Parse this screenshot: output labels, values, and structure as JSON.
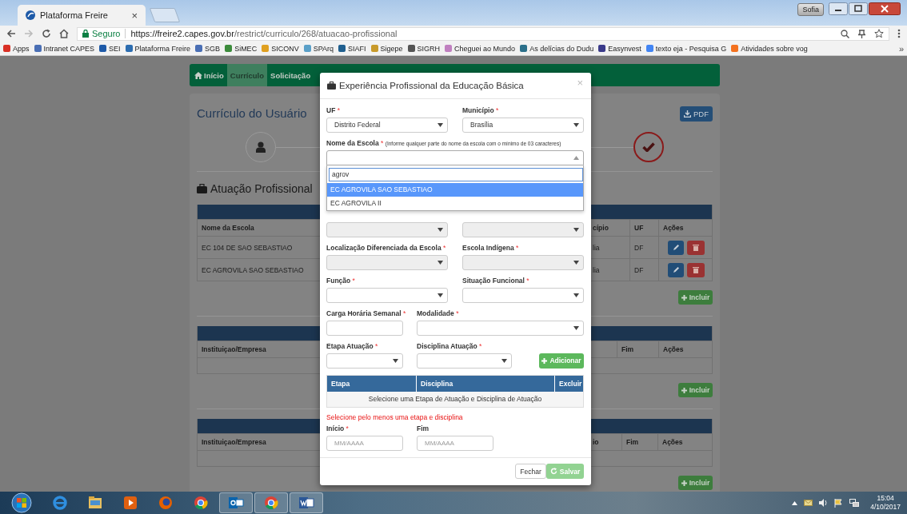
{
  "browser": {
    "tabs": [
      {
        "title": "Plataforma Freire",
        "close": "×",
        "selected": true
      }
    ],
    "profile": "Sofia",
    "address": {
      "security": "Seguro",
      "host": "https://freire2.capes.gov.br",
      "path": "/restrict/curriculo/268/atuacao-profissional"
    },
    "bookmarks": [
      {
        "label": "Apps",
        "color": "#d93025"
      },
      {
        "label": "Intranet CAPES",
        "color": "#4a6fb5"
      },
      {
        "label": "SEI",
        "color": "#1e5aa8"
      },
      {
        "label": "Plataforma Freire",
        "color": "#2c6db0"
      },
      {
        "label": "SGB",
        "color": "#4a6fb5"
      },
      {
        "label": "SiMEC",
        "color": "#3c8c3c"
      },
      {
        "label": "SICONV",
        "color": "#e0a020"
      },
      {
        "label": "SPArq",
        "color": "#5aa0c8"
      },
      {
        "label": "SIAFI",
        "color": "#1f5f8f"
      },
      {
        "label": "Sigepe",
        "color": "#c89a2a"
      },
      {
        "label": "SIGRH",
        "color": "#555555"
      },
      {
        "label": "Cheguei ao Mundo",
        "color": "#c080c0"
      },
      {
        "label": "As delícias do Dudu",
        "color": "#2a6f8a"
      },
      {
        "label": "Easynvest",
        "color": "#3a3a8a"
      },
      {
        "label": "texto eja - Pesquisa G",
        "color": "#4285f4"
      },
      {
        "label": "Atividades sobre vog",
        "color": "#f4711e"
      }
    ],
    "more": "»"
  },
  "nav": [
    {
      "label": "Início",
      "kind": "home",
      "selected": false
    },
    {
      "label": "Currículo",
      "kind": "plain",
      "selected": true
    },
    {
      "label": "Solicitação",
      "kind": "plain",
      "selected": false
    }
  ],
  "page": {
    "title": "Currículo do Usuário",
    "pdf_button": "PDF",
    "steps": [
      {
        "kind": "profile",
        "selected": false
      },
      {
        "kind": "finish",
        "selected": true
      }
    ],
    "section_title": "Atuação Profissional",
    "tables": [
      {
        "columns_left": [
          "Nome da Escola"
        ],
        "columns_right": [
          "cípio",
          "UF",
          "Ações"
        ],
        "rows": [
          {
            "left": "EC 104 DE SAO SEBASTIAO",
            "right": [
              "lia",
              "DF"
            ]
          },
          {
            "left": "EC AGROVILA SAO SEBASTIAO",
            "right": [
              "lia",
              "DF"
            ]
          }
        ],
        "button": "Incluir"
      },
      {
        "columns_left": [
          "Instituiçao/Empresa"
        ],
        "columns_right": [
          "Fim",
          "Ações"
        ],
        "button": "Incluir"
      },
      {
        "columns_left": [
          "Instituiçao/Empresa"
        ],
        "columns_right": [
          "io",
          "Fim",
          "Ações"
        ],
        "button": "Incluir"
      }
    ]
  },
  "modal": {
    "title": "Experiência Profissional da Educação Básica",
    "close": "×",
    "required_mark": "*",
    "rows": [
      {
        "fields": [
          {
            "kind": "select",
            "label": "UF",
            "required": true,
            "value": "Distrito Federal",
            "disabled": false
          },
          {
            "kind": "select",
            "label": "Município",
            "required": true,
            "value": "Brasília",
            "disabled": false
          }
        ]
      },
      {
        "fields": [
          {
            "kind": "select",
            "label": "Nome da Escola",
            "required": true,
            "hint": "(Informe qualquer parte do nome da escola com o mínimo de 03 caracteres)",
            "disabled": false,
            "open": true,
            "search": "agrov",
            "options": [
              {
                "label": "EC AGROVILA SAO SEBASTIAO",
                "selected": true
              },
              {
                "label": "EC AGROVILA II",
                "selected": false
              }
            ]
          }
        ]
      },
      {
        "fields": [
          {
            "kind": "select",
            "disabled": true
          },
          {
            "kind": "select",
            "disabled": true
          }
        ]
      },
      {
        "fields": [
          {
            "kind": "select",
            "label": "Localização Diferenciada da Escola",
            "required": true,
            "disabled": true
          },
          {
            "kind": "select",
            "label": "Escola Indígena",
            "required": true,
            "disabled": true
          }
        ]
      },
      {
        "fields": [
          {
            "kind": "select",
            "label": "Função",
            "required": true,
            "disabled": false
          },
          {
            "kind": "select",
            "label": "Situação Funcional",
            "required": true,
            "disabled": false
          }
        ]
      },
      {
        "fields": [
          {
            "kind": "input",
            "label": "Carga Horária Semanal",
            "required": true
          },
          {
            "kind": "select",
            "label": "Modalidade",
            "required": true,
            "disabled": false
          }
        ]
      },
      {
        "fields": [
          {
            "kind": "select",
            "label": "Etapa Atuação",
            "required": true,
            "disabled": false
          },
          {
            "kind": "select",
            "label": "Disciplina Atuação",
            "required": true,
            "disabled": false
          },
          {
            "kind": "button",
            "label": "Adicionar"
          }
        ]
      }
    ],
    "stage_table": {
      "columns": [
        "Etapa",
        "Disciplina",
        "Excluir"
      ],
      "empty": "Selecione uma Etapa de Atuação e Disciplina de Atuação"
    },
    "error": "Selecione pelo menos uma etapa e disciplina",
    "date_rows": [
      {
        "fields": [
          {
            "kind": "input",
            "label": "Início",
            "required": true,
            "placeholder": "MM/AAAA"
          },
          {
            "kind": "input",
            "label": "Fim",
            "required": false,
            "placeholder": "MM/AAAA"
          }
        ]
      }
    ],
    "buttons": [
      {
        "label": "Fechar",
        "kind": "default",
        "disabled": false
      },
      {
        "label": "Salvar",
        "kind": "save",
        "disabled": true
      }
    ]
  },
  "taskbar": {
    "apps": [
      {
        "kind": "ie",
        "running": false
      },
      {
        "kind": "folder",
        "running": false
      },
      {
        "kind": "media",
        "running": false
      },
      {
        "kind": "firefox",
        "running": false
      },
      {
        "kind": "chrome",
        "running": false
      },
      {
        "kind": "outlook",
        "running": true
      },
      {
        "kind": "chrome",
        "running": true
      },
      {
        "kind": "word",
        "running": true
      }
    ],
    "clock": {
      "time": "15:04",
      "date": "4/10/2017"
    }
  }
}
